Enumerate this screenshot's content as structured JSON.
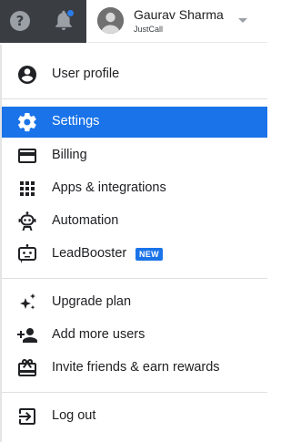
{
  "topbar": {
    "help_icon": "help-circle-icon",
    "help_glyph": "?",
    "bell_icon": "bell-icon",
    "account": {
      "name": "Gaurav Sharma",
      "org": "JustCall",
      "caret_icon": "chevron-down-icon"
    }
  },
  "menu": {
    "items": [
      {
        "label": "User profile",
        "icon": "account-circle-icon",
        "active": false
      },
      {
        "label": "Settings",
        "icon": "gear-icon",
        "active": true
      },
      {
        "label": "Billing",
        "icon": "credit-card-icon",
        "active": false
      },
      {
        "label": "Apps & integrations",
        "icon": "apps-grid-icon",
        "active": false
      },
      {
        "label": "Automation",
        "icon": "robot-icon",
        "active": false
      },
      {
        "label": "LeadBooster",
        "icon": "chat-bot-icon",
        "active": false,
        "badge": "NEW"
      },
      {
        "label": "Upgrade plan",
        "icon": "sparkle-icon",
        "active": false
      },
      {
        "label": "Add more users",
        "icon": "add-user-icon",
        "active": false
      },
      {
        "label": "Invite friends & earn rewards",
        "icon": "gift-icon",
        "active": false
      },
      {
        "label": "Log out",
        "icon": "logout-icon",
        "active": false
      }
    ]
  },
  "colors": {
    "accent": "#1a73e8",
    "topbar_dark": "#3a3d42",
    "notification_dot": "#2b7de9",
    "icon": "#202124"
  }
}
